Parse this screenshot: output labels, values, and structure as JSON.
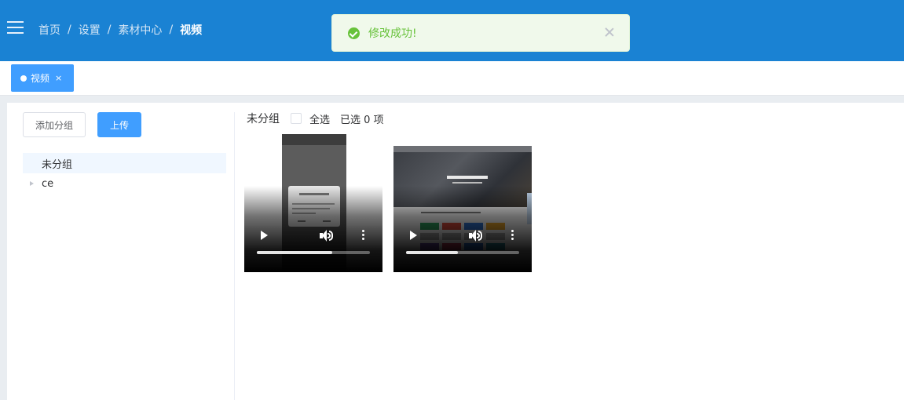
{
  "header": {
    "breadcrumb": [
      "首页",
      "设置",
      "素材中心",
      "视频"
    ],
    "separator": "/"
  },
  "toast": {
    "message": "修改成功!",
    "type": "success",
    "color": "#67c23a"
  },
  "tags": [
    {
      "label": "视频",
      "close": "×",
      "active": true
    }
  ],
  "sidebar": {
    "add_group_label": "添加分组",
    "upload_label": "上传",
    "groups": [
      {
        "label": "未分组",
        "active": true,
        "expandable": false
      },
      {
        "label": "ce",
        "active": false,
        "expandable": true
      }
    ]
  },
  "toolbar": {
    "group_name": "未分组",
    "select_all_label": "全选",
    "selected_count_text": "已选 0 项",
    "select_all_checked": false
  },
  "videos": [
    {
      "thumbnail": "phone-screen-recording",
      "progress": 0.67
    },
    {
      "thumbnail": "website-screen-recording",
      "progress": 0.46
    }
  ],
  "colors": {
    "header_bg": "#1a82d3",
    "primary": "#409eff",
    "success": "#67c23a"
  }
}
